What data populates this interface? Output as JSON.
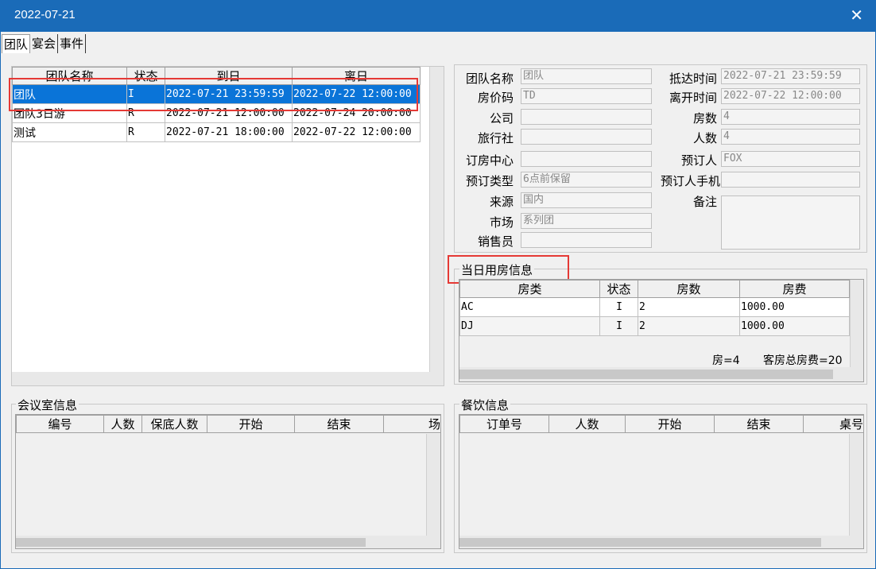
{
  "window": {
    "title": "2022-07-21"
  },
  "tabs": [
    "团队",
    "宴会",
    "事件"
  ],
  "groups_table": {
    "headers": [
      "团队名称",
      "状态",
      "到日",
      "离日"
    ],
    "rows": [
      [
        "团队",
        "I",
        "2022-07-21 23:59:59",
        "2022-07-22 12:00:00"
      ],
      [
        "团队3日游",
        "R",
        "2022-07-21 12:00:00",
        "2022-07-24 20:00:00"
      ],
      [
        "测试",
        "R",
        "2022-07-21 18:00:00",
        "2022-07-22 12:00:00"
      ]
    ]
  },
  "details": {
    "group_name_label": "团队名称",
    "group_name": "团队",
    "rate_code_label": "房价码",
    "rate_code": "TD",
    "company_label": "公司",
    "company": "",
    "agency_label": "旅行社",
    "agency": "",
    "booking_center_label": "订房中心",
    "booking_center": "",
    "booking_type_label": "预订类型",
    "booking_type": "6点前保留",
    "source_label": "来源",
    "source": "国内",
    "market_label": "市场",
    "market": "系列团",
    "sales_label": "销售员",
    "sales": "",
    "arrival_label": "抵达时间",
    "arrival": "2022-07-21 23:59:59",
    "departure_label": "离开时间",
    "departure": "2022-07-22 12:00:00",
    "rooms_label": "房数",
    "rooms": "4",
    "persons_label": "人数",
    "persons": "4",
    "booker_label": "预订人",
    "booker": "FOX",
    "booker_phone_label": "预订人手机",
    "booker_phone": "",
    "remark_label": "备注",
    "remark": ""
  },
  "room_usage": {
    "title": "当日用房信息",
    "headers": [
      "房类",
      "状态",
      "房数",
      "房费"
    ],
    "rows": [
      [
        "AC",
        "I",
        "2",
        "1000.00"
      ],
      [
        "DJ",
        "I",
        "2",
        "1000.00"
      ]
    ],
    "footer_rooms": "房=4",
    "footer_total": "客房总房费=20"
  },
  "meeting": {
    "title": "会议室信息",
    "headers": [
      "编号",
      "人数",
      "保底人数",
      "开始",
      "结束",
      "场"
    ]
  },
  "dining": {
    "title": "餐饮信息",
    "headers": [
      "订单号",
      "人数",
      "开始",
      "结束",
      "桌号"
    ]
  }
}
